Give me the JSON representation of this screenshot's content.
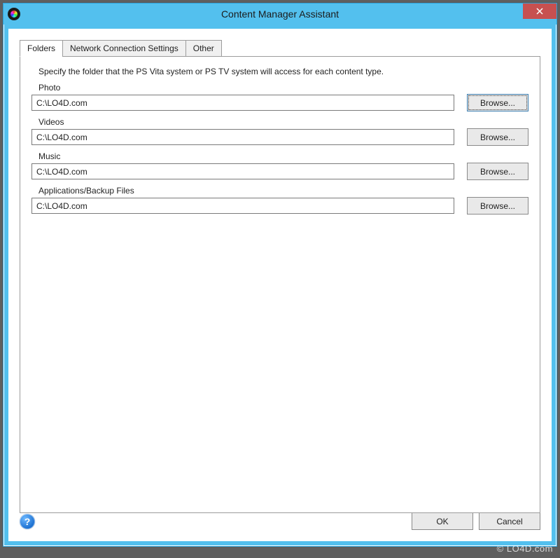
{
  "window": {
    "title": "Content Manager Assistant"
  },
  "tabs": {
    "folders": "Folders",
    "network": "Network Connection Settings",
    "other": "Other"
  },
  "instructions": "Specify the folder that the PS Vita system or PS TV system will access for each content type.",
  "sections": {
    "photo": {
      "label": "Photo",
      "path": "C:\\LO4D.com",
      "browse": "Browse..."
    },
    "videos": {
      "label": "Videos",
      "path": "C:\\LO4D.com",
      "browse": "Browse..."
    },
    "music": {
      "label": "Music",
      "path": "C:\\LO4D.com",
      "browse": "Browse..."
    },
    "apps": {
      "label": "Applications/Backup Files",
      "path": "C:\\LO4D.com",
      "browse": "Browse..."
    }
  },
  "buttons": {
    "ok": "OK",
    "cancel": "Cancel"
  },
  "help_glyph": "?",
  "watermark": "© LO4D.com"
}
